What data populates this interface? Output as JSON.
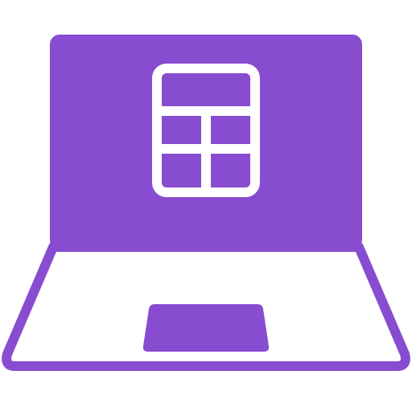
{
  "icon": {
    "name": "laptop-calculator-icon",
    "parts": [
      "laptop-screen",
      "calculator-icon",
      "laptop-base",
      "touchpad"
    ]
  },
  "colors": {
    "accent": "#884CD1",
    "background": "#FFFFFF"
  }
}
